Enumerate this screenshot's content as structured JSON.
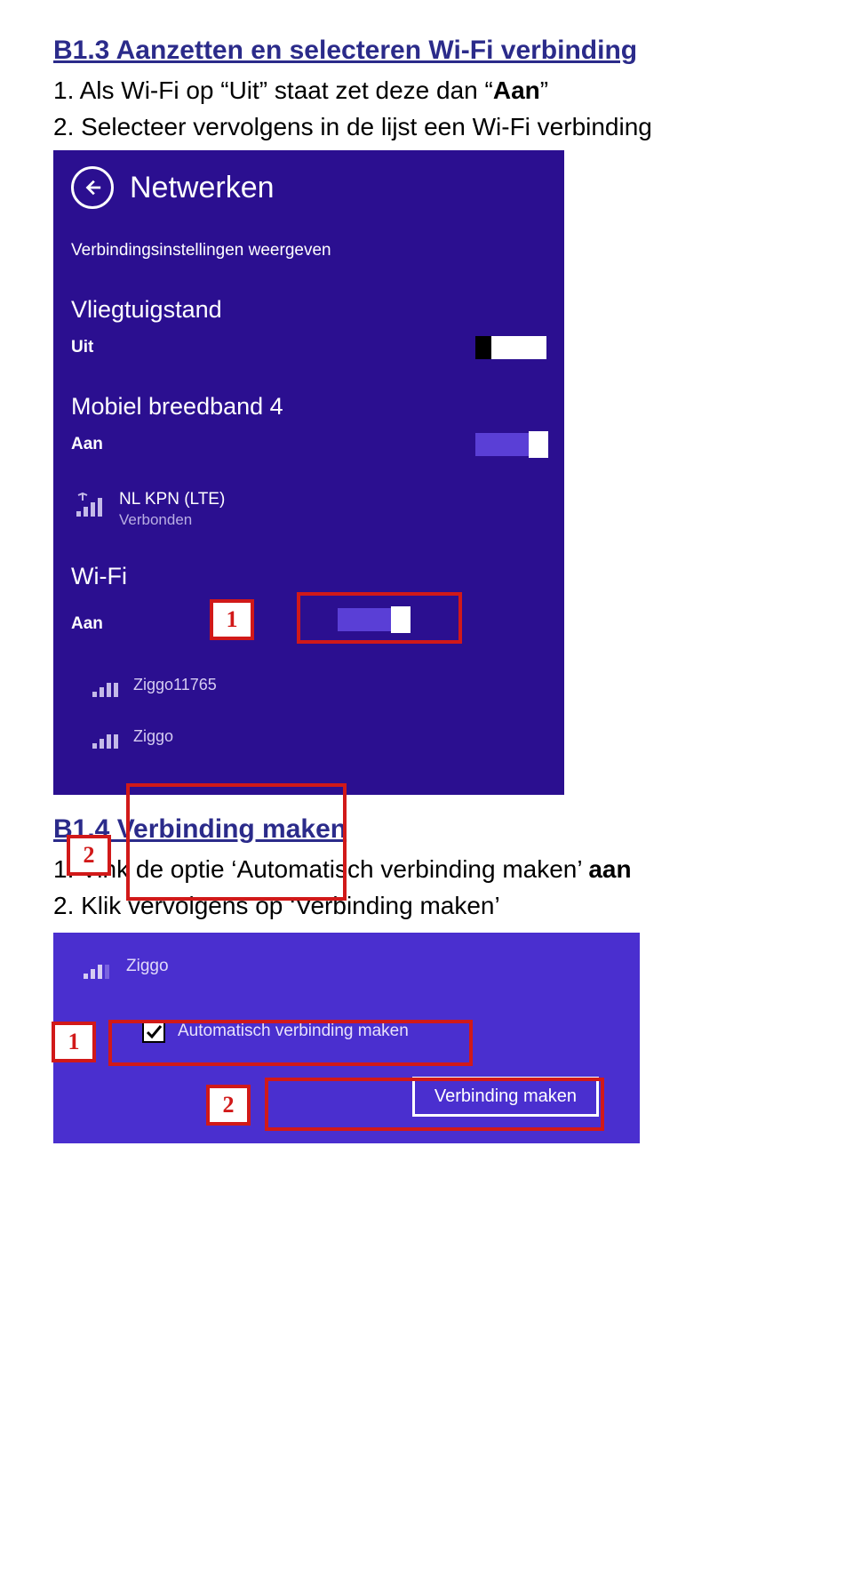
{
  "section1": {
    "heading": "B1.3 Aanzetten en selecteren Wi-Fi verbinding",
    "step1_prefix": "1. Als Wi-Fi op “Uit” staat zet deze dan “",
    "step1_bold": "Aan",
    "step1_suffix": "”",
    "step2": "2. Selecteer vervolgens in de lijst een Wi-Fi verbinding"
  },
  "badges": {
    "one": "1",
    "two": "2"
  },
  "panel": {
    "title": "Netwerken",
    "settings_link": "Verbindingsinstellingen weergeven",
    "airplane": {
      "title": "Vliegtuigstand",
      "state": "Uit"
    },
    "broadband": {
      "title": "Mobiel breedband 4",
      "state": "Aan",
      "provider": "NL KPN (LTE)",
      "status": "Verbonden"
    },
    "wifi": {
      "title": "Wi-Fi",
      "state": "Aan",
      "networks": [
        "Ziggo11765",
        "Ziggo"
      ]
    }
  },
  "section2": {
    "heading": "B1.4 Verbinding maken",
    "step1_prefix": "1. Vink de optie ‘Automatisch verbinding maken’ ",
    "step1_bold": "aan",
    "step2": "2. Klik vervolgens op ‘Verbinding maken’"
  },
  "panel2": {
    "network": "Ziggo",
    "checkbox_label": "Automatisch verbinding maken",
    "button": "Verbinding maken"
  }
}
